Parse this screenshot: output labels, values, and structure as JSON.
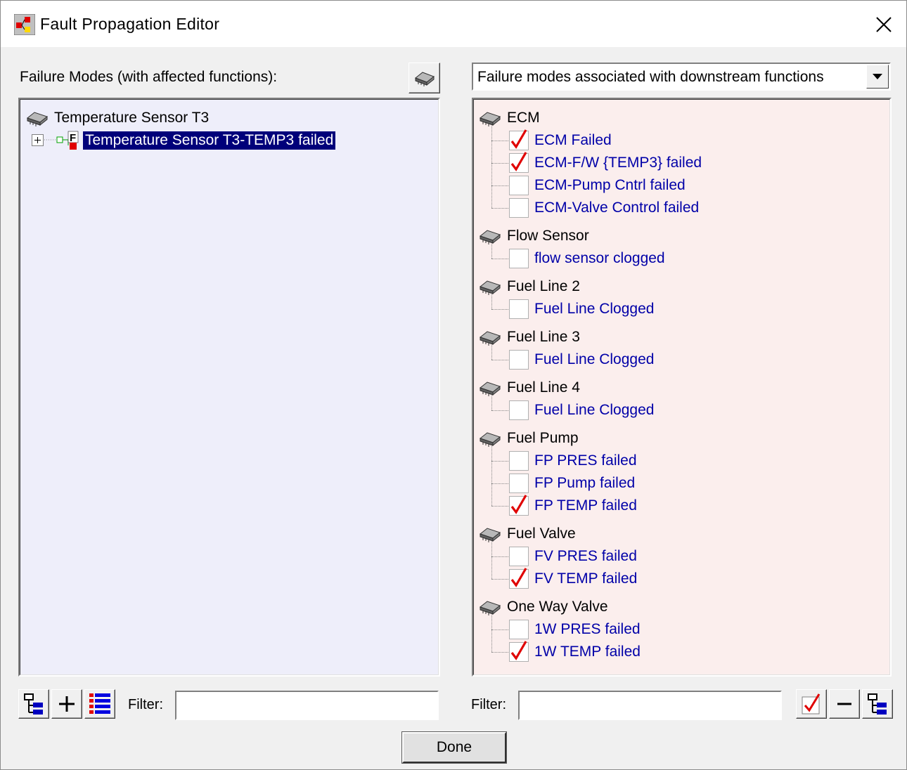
{
  "window": {
    "title": "Fault Propagation Editor"
  },
  "left": {
    "header": "Failure Modes (with affected functions):",
    "tree": {
      "root_label": "Temperature Sensor T3",
      "selected_item": "Temperature Sensor T3-TEMP3 failed"
    },
    "filter_label": "Filter:",
    "filter_value": ""
  },
  "right": {
    "dropdown_value": "Failure modes associated with downstream functions",
    "filter_label": "Filter:",
    "filter_value": "",
    "groups": [
      {
        "name": "ECM",
        "items": [
          {
            "label": "ECM Failed",
            "checked": true
          },
          {
            "label": "ECM-F/W {TEMP3} failed",
            "checked": true
          },
          {
            "label": "ECM-Pump Cntrl failed",
            "checked": false
          },
          {
            "label": "ECM-Valve Control failed",
            "checked": false
          }
        ]
      },
      {
        "name": "Flow Sensor",
        "items": [
          {
            "label": "flow sensor clogged",
            "checked": false
          }
        ]
      },
      {
        "name": "Fuel Line 2",
        "items": [
          {
            "label": "Fuel Line Clogged",
            "checked": false
          }
        ]
      },
      {
        "name": "Fuel Line 3",
        "items": [
          {
            "label": "Fuel Line Clogged",
            "checked": false
          }
        ]
      },
      {
        "name": "Fuel Line 4",
        "items": [
          {
            "label": "Fuel Line Clogged",
            "checked": false
          }
        ]
      },
      {
        "name": "Fuel Pump",
        "items": [
          {
            "label": "FP PRES failed",
            "checked": false
          },
          {
            "label": "FP Pump failed",
            "checked": false
          },
          {
            "label": "FP TEMP failed",
            "checked": true
          }
        ]
      },
      {
        "name": "Fuel Valve",
        "items": [
          {
            "label": "FV PRES failed",
            "checked": false
          },
          {
            "label": "FV TEMP failed",
            "checked": true
          }
        ]
      },
      {
        "name": "One Way Valve",
        "items": [
          {
            "label": "1W PRES failed",
            "checked": false
          },
          {
            "label": "1W TEMP failed",
            "checked": true
          }
        ]
      }
    ]
  },
  "buttons": {
    "done_label": "Done"
  },
  "colors": {
    "selection_bg": "#00007a",
    "item_text": "#0000a8",
    "check_red": "#e00000",
    "left_panel_bg": "#eeeefa",
    "right_panel_bg": "#fbeeed"
  }
}
